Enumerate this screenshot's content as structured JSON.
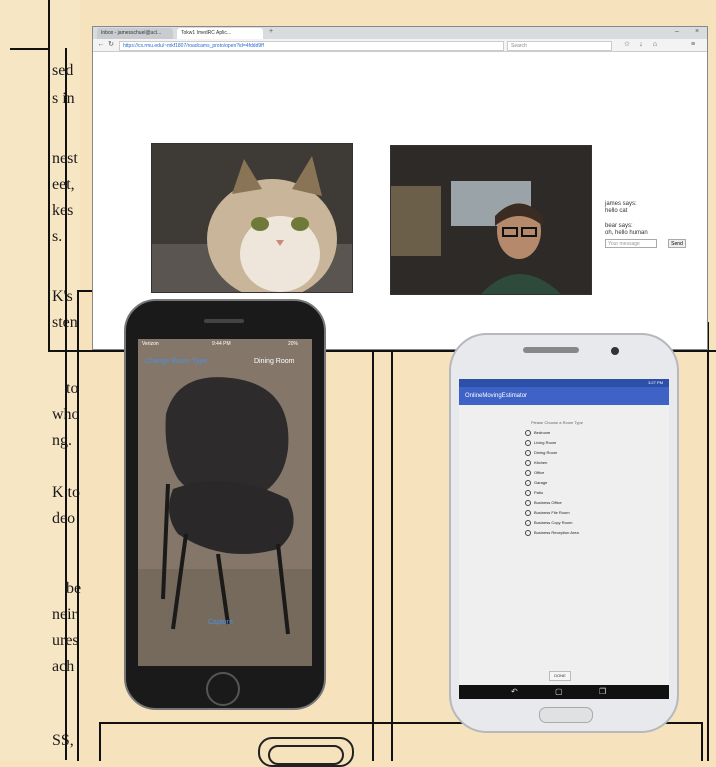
{
  "paper": {
    "lines": [
      "sed",
      "s in",
      "nest",
      "eet,",
      "kes",
      "s.",
      "K's",
      "sten",
      "to",
      "who",
      "ng.",
      "K to",
      "deo",
      "be",
      "neir",
      "ures",
      "ach",
      "SS,"
    ]
  },
  "browser": {
    "tabs": [
      {
        "label": "Inbox - jamesschuel@ucl..."
      },
      {
        "label": "Tokw1 ImedRC Aplic..."
      }
    ],
    "url": "https://cs.rmu.edu/~mkf1807/roadcams_proto/open?id=4fddd9ff",
    "url_host": "rmu.edu",
    "search_placeholder": "Search",
    "chat": {
      "line1_name": "james says:",
      "line1_msg": "hello cat",
      "line2_name": "bear says:",
      "line2_msg": "oh, hello human",
      "input_placeholder": "Your message",
      "send_label": "Send"
    }
  },
  "iphone": {
    "carrier": "Verizon",
    "time": "9:44 PM",
    "battery": "20%",
    "change_room_label": "Change Room Type",
    "room_label": "Dining Room",
    "capture_label": "Capture"
  },
  "android": {
    "time": "3:27 PM",
    "app_title": "OnlineMovingEstimator",
    "prompt": "Please Choose a Room Type",
    "options": [
      "Bedroom",
      "Living Room",
      "Dining Room",
      "Kitchen",
      "Office",
      "Garage",
      "Patio",
      "Business Office",
      "Business File Room",
      "Business Copy Room",
      "Business Reception Area"
    ],
    "done_label": "DONE"
  },
  "colors": {
    "paper": "#f6e3bd",
    "android_appbar": "#3f62c6",
    "ios_link": "#4a90e2"
  }
}
